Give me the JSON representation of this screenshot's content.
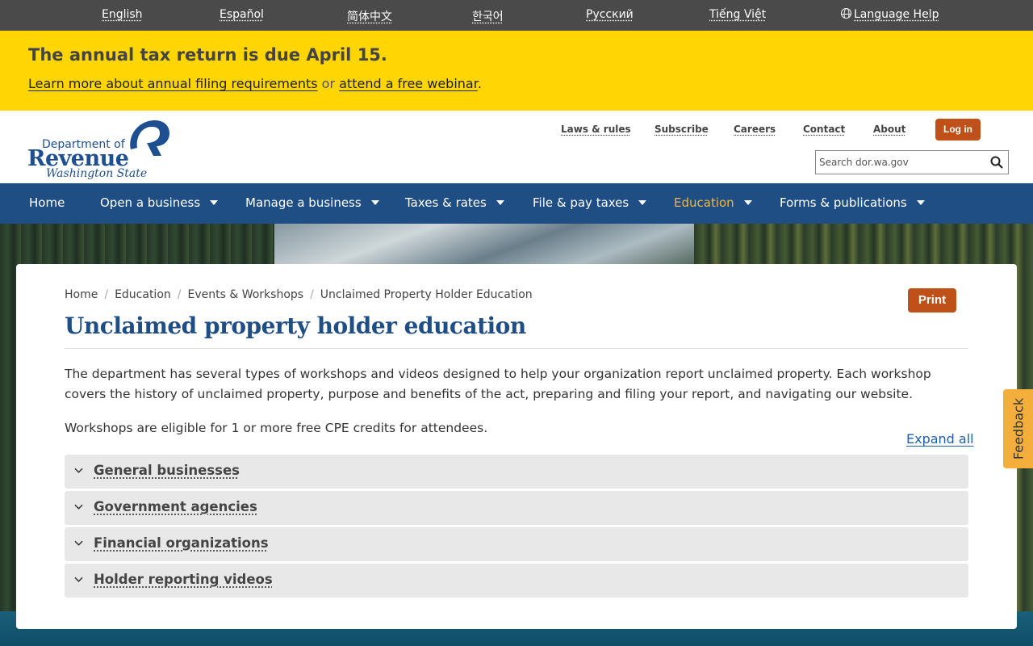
{
  "languages": [
    {
      "label": "English"
    },
    {
      "label": "Español"
    },
    {
      "label": "简体中文"
    },
    {
      "label": "한국어"
    },
    {
      "label": "Русский"
    },
    {
      "label": "Tiếng Việt"
    }
  ],
  "language_help": "Language Help",
  "alert": {
    "title": "The annual tax return is due April 15.",
    "link1": "Learn more about annual filing requirements",
    "or": "or",
    "link2": "attend a free webinar",
    "period": "."
  },
  "logo": {
    "dept": "Department of",
    "revenue": "Revenue",
    "state": "Washington State"
  },
  "utility_links": [
    "Laws & rules",
    "Subscribe",
    "Careers",
    "Contact",
    "About"
  ],
  "login_label": "Log in",
  "search": {
    "placeholder": "Search dor.wa.gov"
  },
  "nav": [
    {
      "label": "Home"
    },
    {
      "label": "Open a business"
    },
    {
      "label": "Manage a business"
    },
    {
      "label": "Taxes & rates"
    },
    {
      "label": "File & pay taxes"
    },
    {
      "label": "Education"
    },
    {
      "label": "Forms & publications"
    }
  ],
  "breadcrumb": [
    "Home",
    "Education",
    "Events & Workshops",
    "Unclaimed Property Holder Education"
  ],
  "print_label": "Print",
  "page_title": "Unclaimed property holder education",
  "paragraphs": [
    "The department has several types of workshops and videos designed to help your organization report unclaimed property. Each workshop covers the history of unclaimed property, purpose and benefits of the act, preparing and filing your report, and navigating our website.",
    "Workshops are eligible for 1 or more free CPE credits for attendees."
  ],
  "expand_all": "Expand all",
  "accordions": [
    "General businesses",
    "Government agencies",
    "Financial organizations",
    "Holder reporting videos"
  ],
  "feedback_label": "Feedback",
  "colors": {
    "brand_blue": "#1f4e85",
    "alert_yellow": "#ffd603",
    "button_orange": "#bf5118",
    "active_nav": "#f0b73e",
    "feedback": "#f3ae3c"
  }
}
